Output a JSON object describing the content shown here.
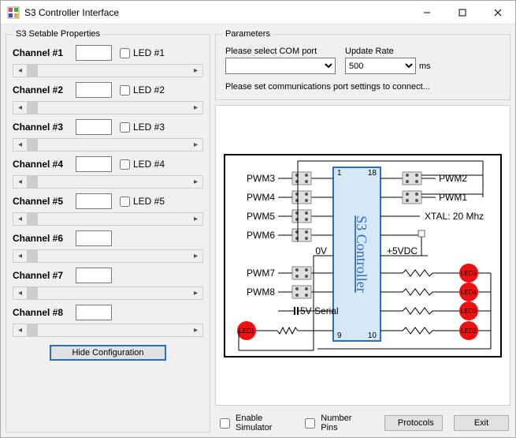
{
  "window": {
    "title": "S3 Controller Interface"
  },
  "setable": {
    "legend": "S3 Setable Properties",
    "channels": [
      {
        "label": "Channel #1",
        "value": "",
        "led_label": "LED #1",
        "has_led": true
      },
      {
        "label": "Channel #2",
        "value": "",
        "led_label": "LED #2",
        "has_led": true
      },
      {
        "label": "Channel #3",
        "value": "",
        "led_label": "LED #3",
        "has_led": true
      },
      {
        "label": "Channel #4",
        "value": "",
        "led_label": "LED #4",
        "has_led": true
      },
      {
        "label": "Channel #5",
        "value": "",
        "led_label": "LED #5",
        "has_led": true
      },
      {
        "label": "Channel #6",
        "value": "",
        "led_label": "",
        "has_led": false
      },
      {
        "label": "Channel #7",
        "value": "",
        "led_label": "",
        "has_led": false
      },
      {
        "label": "Channel #8",
        "value": "",
        "led_label": "",
        "has_led": false
      }
    ],
    "hide_btn": "Hide Configuration"
  },
  "params": {
    "legend": "Parameters",
    "com_label": "Please select COM port",
    "com_value": "",
    "rate_label": "Update Rate",
    "rate_value": "500",
    "rate_unit": "ms",
    "msg": "Please set communications port settings to connect..."
  },
  "diagram": {
    "chip_label": "S3 Controller",
    "pin_top_left": "1",
    "pin_top_right": "18",
    "pin_bottom_left": "9",
    "pin_bottom_right": "10",
    "left_labels": [
      "PWM3",
      "PWM4",
      "PWM5",
      "PWM6",
      "PWM7",
      "PWM8"
    ],
    "right_top_labels": [
      "PWM2",
      "PWM1"
    ],
    "xtal_label": "XTAL: 20 Mhz",
    "v0_label": "0V",
    "v5_label": "+5VDC",
    "serial_label": "5V Serial",
    "led_labels": [
      "LED1",
      "LED2",
      "LED3",
      "LED4",
      "LED5"
    ]
  },
  "bottom": {
    "enable_sim": "Enable Simulator",
    "number_pins": "Number Pins",
    "protocols_btn": "Protocols",
    "exit_btn": "Exit"
  }
}
